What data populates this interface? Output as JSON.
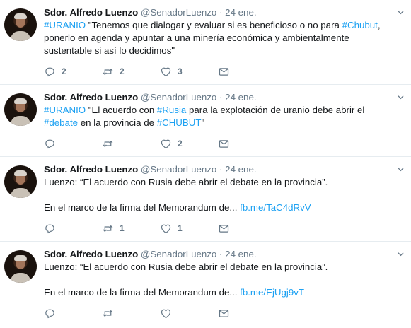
{
  "tweets": [
    {
      "name": "Sdor. Alfredo Luenzo",
      "handle": "@SenadorLuenzo",
      "separator": "·",
      "date": "24 ene.",
      "text": [
        {
          "t": "#URANIO",
          "link": true
        },
        {
          "t": " \"Tenemos que dialogar y evaluar si es beneficioso o no para ",
          "link": false
        },
        {
          "t": "#Chubut",
          "link": true
        },
        {
          "t": ",\nponerlo en agenda y apuntar a una minería económica y ambientalmente\nsustentable si así lo decidimos\"",
          "link": false
        }
      ],
      "replies": "2",
      "retweets": "2",
      "likes": "3"
    },
    {
      "name": "Sdor. Alfredo Luenzo",
      "handle": "@SenadorLuenzo",
      "separator": "·",
      "date": "24 ene.",
      "text": [
        {
          "t": "#URANIO",
          "link": true
        },
        {
          "t": " \"El acuerdo con ",
          "link": false
        },
        {
          "t": "#Rusia",
          "link": true
        },
        {
          "t": " para la explotación de uranio debe abrir el\n",
          "link": false
        },
        {
          "t": "#debate",
          "link": true
        },
        {
          "t": " en la provincia de ",
          "link": false
        },
        {
          "t": "#CHUBUT",
          "link": true
        },
        {
          "t": "\"",
          "link": false
        }
      ],
      "replies": "",
      "retweets": "",
      "likes": "2"
    },
    {
      "name": "Sdor. Alfredo Luenzo",
      "handle": "@SenadorLuenzo",
      "separator": "·",
      "date": "24 ene.",
      "text": [
        {
          "t": "Luenzo: “El acuerdo con Rusia debe abrir el debate en la provincia”.\n\nEn el marco de la firma del Memorandum de... ",
          "link": false
        },
        {
          "t": "fb.me/TaC4dRvV",
          "link": true
        }
      ],
      "replies": "",
      "retweets": "1",
      "likes": "1"
    },
    {
      "name": "Sdor. Alfredo Luenzo",
      "handle": "@SenadorLuenzo",
      "separator": "·",
      "date": "24 ene.",
      "text": [
        {
          "t": "Luenzo: “El acuerdo con Rusia debe abrir el debate en la provincia”.\n\nEn el marco de la firma del Memorandum de... ",
          "link": false
        },
        {
          "t": "fb.me/EjUgj9vT",
          "link": true
        }
      ],
      "replies": "",
      "retweets": "",
      "likes": "",
      "cut_off": true
    }
  ],
  "icons": {
    "reply": "reply-icon",
    "retweet": "retweet-icon",
    "like": "heart-icon",
    "dm": "envelope-icon",
    "menu": "chevron-down-icon"
  },
  "colors": {
    "link": "#1da1f2",
    "secondary": "#657786",
    "text": "#14171a",
    "divider": "#e6ecf0"
  }
}
